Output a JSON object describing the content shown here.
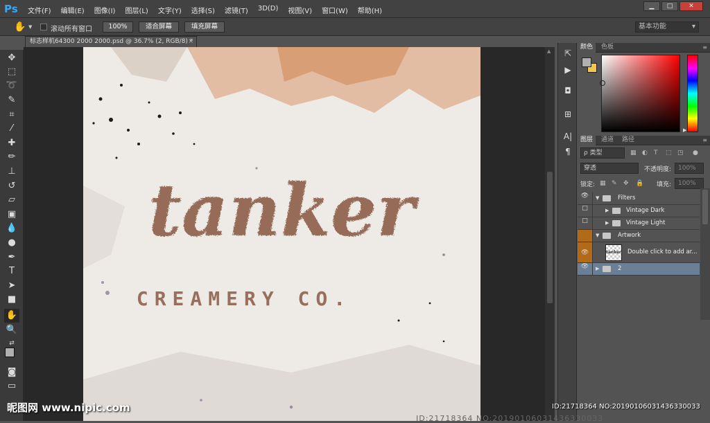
{
  "app": {
    "logo": "Ps"
  },
  "menu": [
    "文件(F)",
    "编辑(E)",
    "图像(I)",
    "图层(L)",
    "文字(Y)",
    "选择(S)",
    "滤镜(T)",
    "3D(D)",
    "视图(V)",
    "窗口(W)",
    "帮助(H)"
  ],
  "window_controls": {
    "minimize": "▁",
    "maximize": "□",
    "close": "✕"
  },
  "options": {
    "tool_icon": "hand-tool-icon",
    "scroll_all_label": "滚动所有窗口",
    "zoom_100_label": "100%",
    "fit_screen_label": "适合屏幕",
    "fill_screen_label": "填充屏幕",
    "workspace_label": "基本功能"
  },
  "document": {
    "tab_title": "标志样机64300 2000 2000.psd @ 36.7% (2, RGB/8) *",
    "close": "×"
  },
  "artwork": {
    "title": "tanker",
    "subtitle": "CREAMERY CO."
  },
  "color_panel": {
    "tabs": [
      "颜色",
      "色板"
    ],
    "fg_color": "#b0b0b0",
    "bg_color": "#f3c64c",
    "hue": "#ff0000"
  },
  "layers_panel": {
    "tabs": [
      "图层",
      "通道",
      "路径"
    ],
    "filter_label": "ρ 类型",
    "blend_mode": "穿透",
    "opacity_label": "不透明度:",
    "opacity_value": "100%",
    "lock_label": "锁定:",
    "fill_label": "填充:",
    "fill_value": "100%",
    "layers": [
      {
        "name": "Filters",
        "type": "group",
        "expanded": true,
        "visible": true
      },
      {
        "name": "Vintage Dark",
        "type": "group",
        "expanded": false,
        "visible": false
      },
      {
        "name": "Vintage Light",
        "type": "group",
        "expanded": false,
        "visible": false
      },
      {
        "name": "Artwork",
        "type": "group",
        "expanded": true,
        "visible": false
      },
      {
        "name": "Double click to add ar...",
        "type": "smart-object",
        "thumb_text": "tanker",
        "visible": true
      },
      {
        "name": "2",
        "type": "group",
        "expanded": false,
        "visible": true,
        "selected": true
      }
    ]
  },
  "watermark": {
    "left": "昵图网 www.nipic.com",
    "right": "ID:21718364 NO:20190106031436330033"
  },
  "faint_text": "ID:21718364 NO:20190106031436330033"
}
